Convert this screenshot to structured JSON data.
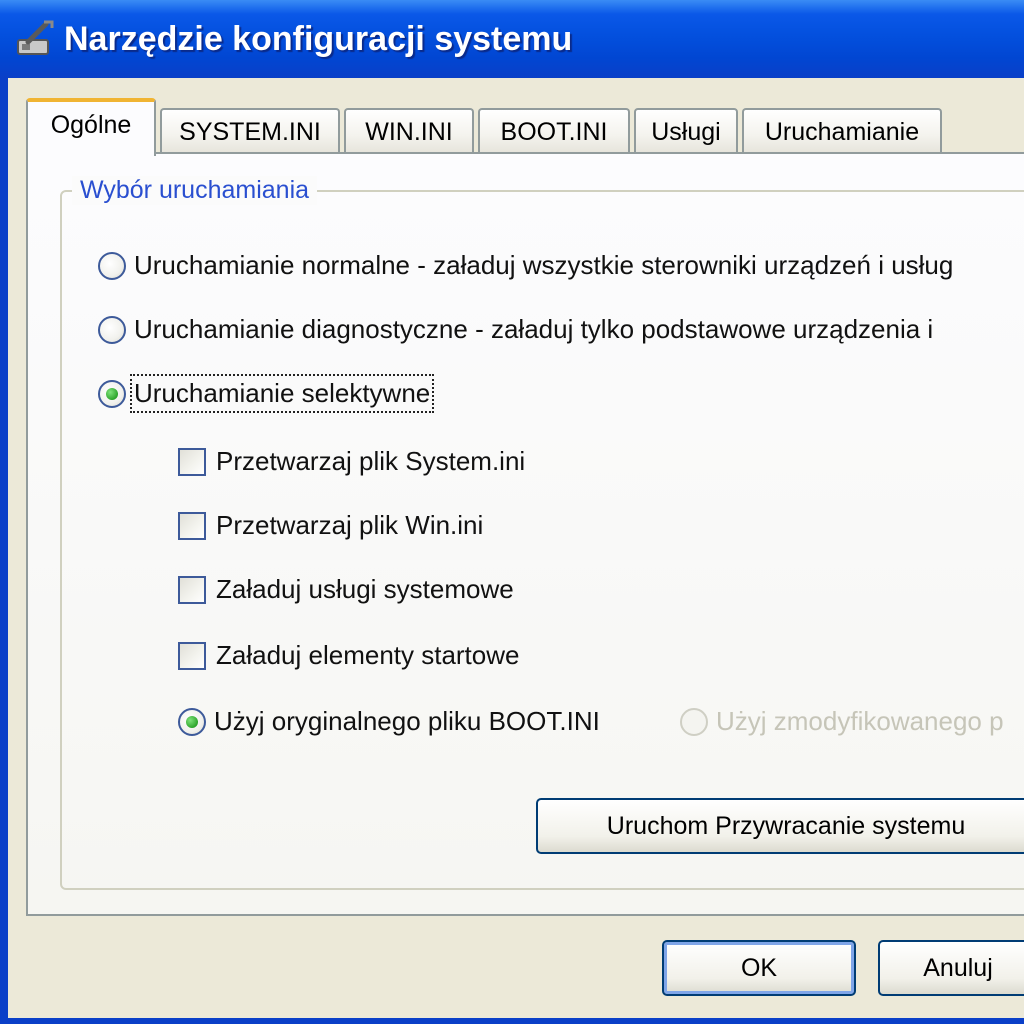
{
  "window": {
    "title": "Narzędzie konfiguracji systemu",
    "title_icon": "msconfig-wrench-icon",
    "frame_color": "#0a3fc8",
    "title_color": "#0350de"
  },
  "tabs": [
    {
      "label": "Ogólne",
      "active": true
    },
    {
      "label": "SYSTEM.INI",
      "active": false
    },
    {
      "label": "WIN.INI",
      "active": false
    },
    {
      "label": "BOOT.INI",
      "active": false
    },
    {
      "label": "Usługi",
      "active": false
    },
    {
      "label": "Uruchamianie",
      "active": false
    }
  ],
  "general": {
    "group_label": "Wybór uruchamiania",
    "startup_options": {
      "normal": {
        "label": "Uruchamianie normalne - załaduj wszystkie sterowniki urządzeń i usług",
        "checked": false
      },
      "diagnostic": {
        "label": "Uruchamianie diagnostyczne - załaduj tylko podstawowe urządzenia i",
        "checked": false
      },
      "selective": {
        "label": "Uruchamianie selektywne",
        "checked": true
      }
    },
    "selective_options": {
      "process_system_ini": {
        "label": "Przetwarzaj plik System.ini",
        "checked": false
      },
      "process_win_ini": {
        "label": "Przetwarzaj plik Win.ini",
        "checked": false
      },
      "load_system_services": {
        "label": "Załaduj usługi systemowe",
        "checked": false
      },
      "load_startup_items": {
        "label": "Załaduj elementy startowe",
        "checked": false
      }
    },
    "boot_ini": {
      "original": {
        "label": "Użyj oryginalnego pliku BOOT.INI",
        "checked": true
      },
      "modified": {
        "label": "Użyj zmodyfikowanego p",
        "checked": false,
        "enabled": false
      }
    },
    "restore_button_label": "Uruchom Przywracanie systemu"
  },
  "dialog_buttons": {
    "ok_label": "OK",
    "cancel_label": "Anuluj"
  }
}
